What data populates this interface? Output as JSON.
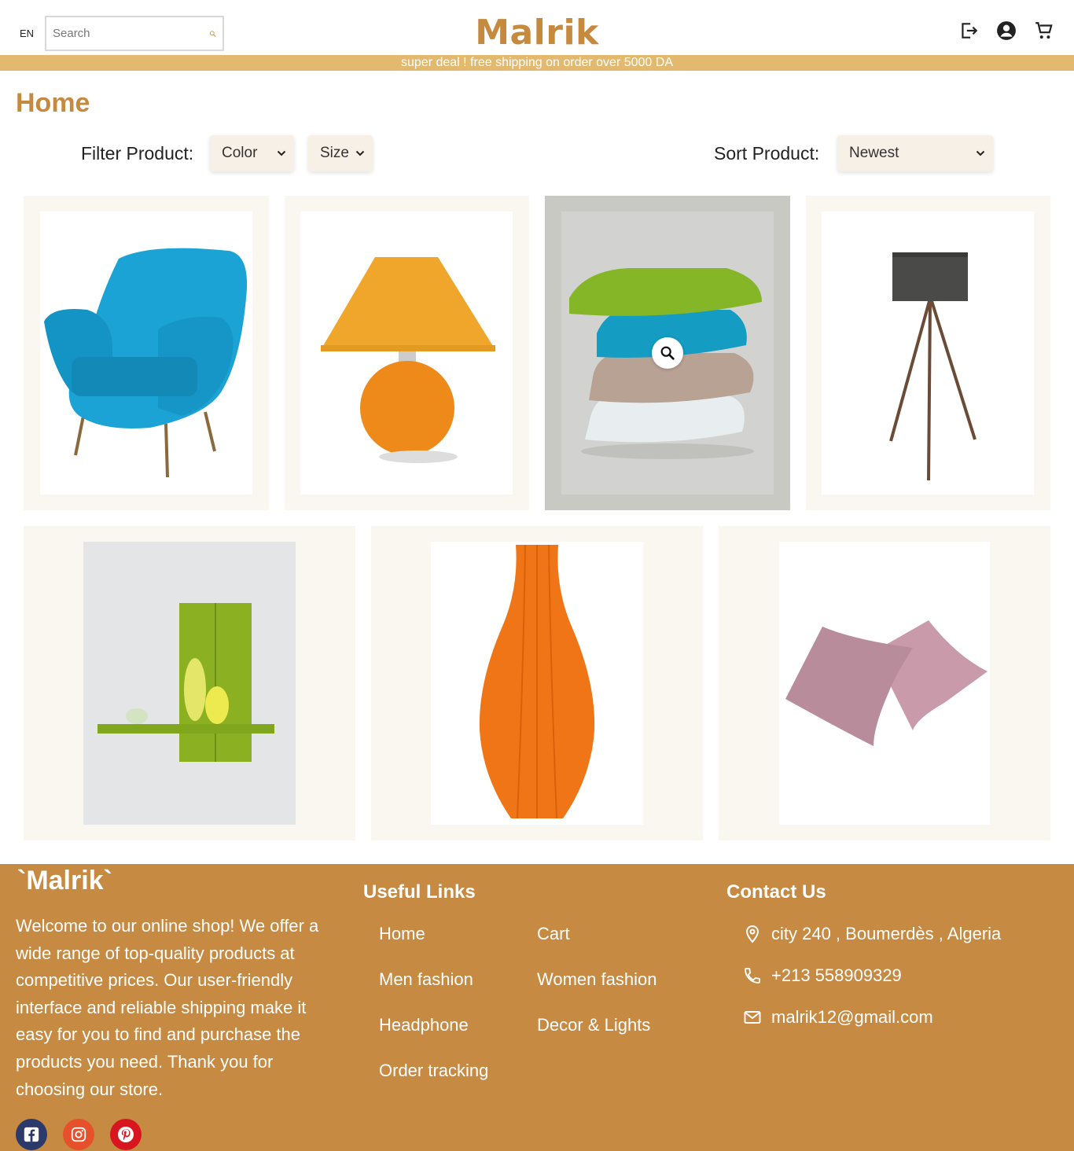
{
  "header": {
    "lang": "EN",
    "search_placeholder": "Search",
    "logo": "Malrik",
    "icons": [
      "logout-icon",
      "account-icon",
      "cart-icon"
    ]
  },
  "promo": "super deal ! free shipping on order over 5000 DA",
  "page_title": "Home",
  "filters": {
    "filter_label": "Filter Product:",
    "color": "Color",
    "size": "Size",
    "sort_label": "Sort Product:",
    "sort": "Newest"
  },
  "products": [
    {
      "image": "blue-armchair"
    },
    {
      "image": "orange-table-lamp"
    },
    {
      "image": "stacked-pillows"
    },
    {
      "image": "tripod-floor-lamp"
    },
    {
      "image": "green-wall-shelf"
    },
    {
      "image": "orange-vase"
    },
    {
      "image": "pink-pillows"
    }
  ],
  "footer": {
    "logo": "`Malrik`",
    "about": "Welcome to our online shop! We offer a wide range of top-quality products at competitive prices. Our user-friendly interface and reliable shipping make it easy for you to find and purchase the products you need. Thank you for choosing our store.",
    "useful_links_title": "Useful Links",
    "links": [
      "Home",
      "Cart",
      "Men fashion",
      "Women fashion",
      "Headphone",
      "Decor & Lights",
      "Order tracking"
    ],
    "contact_title": "Contact Us",
    "address": "city 240 , Boumerdès , Algeria",
    "phone": "+213 558909329",
    "email": "malrik12@gmail.com",
    "social": [
      "facebook-icon",
      "instagram-icon",
      "pinterest-icon"
    ]
  },
  "colors": {
    "brand": "#c68a3f",
    "promo_bar": "#e3b96f",
    "footer_bg": "#c68a42",
    "card_bg": "#f9f7f0",
    "select_bg": "#f7f0e6"
  }
}
